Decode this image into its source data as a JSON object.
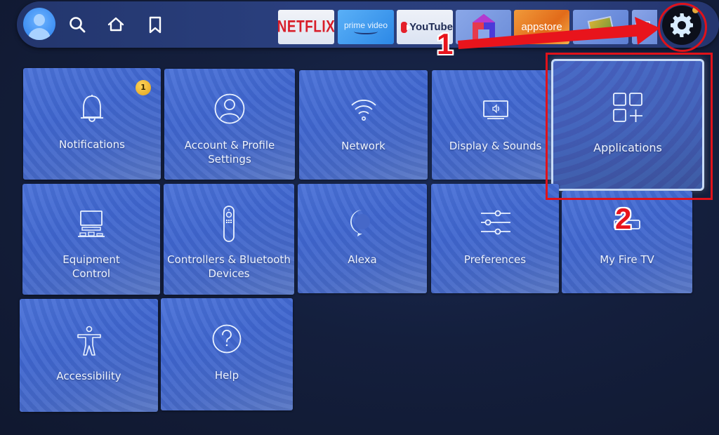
{
  "navbar": {
    "profile": {
      "icon": "user-avatar-icon"
    },
    "nav_icons": [
      {
        "name": "search",
        "icon": "search-icon"
      },
      {
        "name": "home",
        "icon": "home-icon"
      },
      {
        "name": "watchlist",
        "icon": "bookmark-icon"
      }
    ],
    "apps": [
      {
        "name": "netflix",
        "label": "NETFLIX",
        "brand_color": "#d81e2a"
      },
      {
        "name": "prime-video",
        "label": "prime video",
        "brand_color": "#2c88e6"
      },
      {
        "name": "youtube",
        "label": "YouTube",
        "brand_color": "#e4202a"
      },
      {
        "name": "mobdro",
        "label": ""
      },
      {
        "name": "appstore",
        "label": "appstore",
        "brand_color": "#e26b1a"
      },
      {
        "name": "app-6",
        "label": ""
      },
      {
        "name": "all-apps",
        "label": ""
      }
    ],
    "settings": {
      "icon": "gear-icon",
      "has_notification_dot": true
    }
  },
  "tiles": [
    {
      "id": "notifications",
      "label": "Notifications",
      "icon": "bell-icon",
      "badge": "1"
    },
    {
      "id": "account-profile-settings",
      "label": "Account & Profile\nSettings",
      "icon": "user-circle-icon"
    },
    {
      "id": "network",
      "label": "Network",
      "icon": "wifi-icon"
    },
    {
      "id": "display-sounds",
      "label": "Display & Sounds",
      "icon": "tv-speaker-icon"
    },
    {
      "id": "applications",
      "label": "Applications",
      "icon": "apps-grid-plus-icon",
      "focused": true
    },
    {
      "id": "equipment-control",
      "label": "Equipment\nControl",
      "icon": "equipment-icon"
    },
    {
      "id": "controllers-bluetooth",
      "label": "Controllers & Bluetooth\nDevices",
      "icon": "remote-icon"
    },
    {
      "id": "alexa",
      "label": "Alexa",
      "icon": "alexa-icon"
    },
    {
      "id": "preferences",
      "label": "Preferences",
      "icon": "sliders-icon"
    },
    {
      "id": "my-fire-tv",
      "label": "My Fire TV",
      "icon": "fire-tv-stick-icon"
    },
    {
      "id": "accessibility",
      "label": "Accessibility",
      "icon": "accessibility-icon"
    },
    {
      "id": "help",
      "label": "Help",
      "icon": "help-circle-icon"
    }
  ],
  "annotations": {
    "step1": "1",
    "step2": "2",
    "color": "#e0121a"
  }
}
